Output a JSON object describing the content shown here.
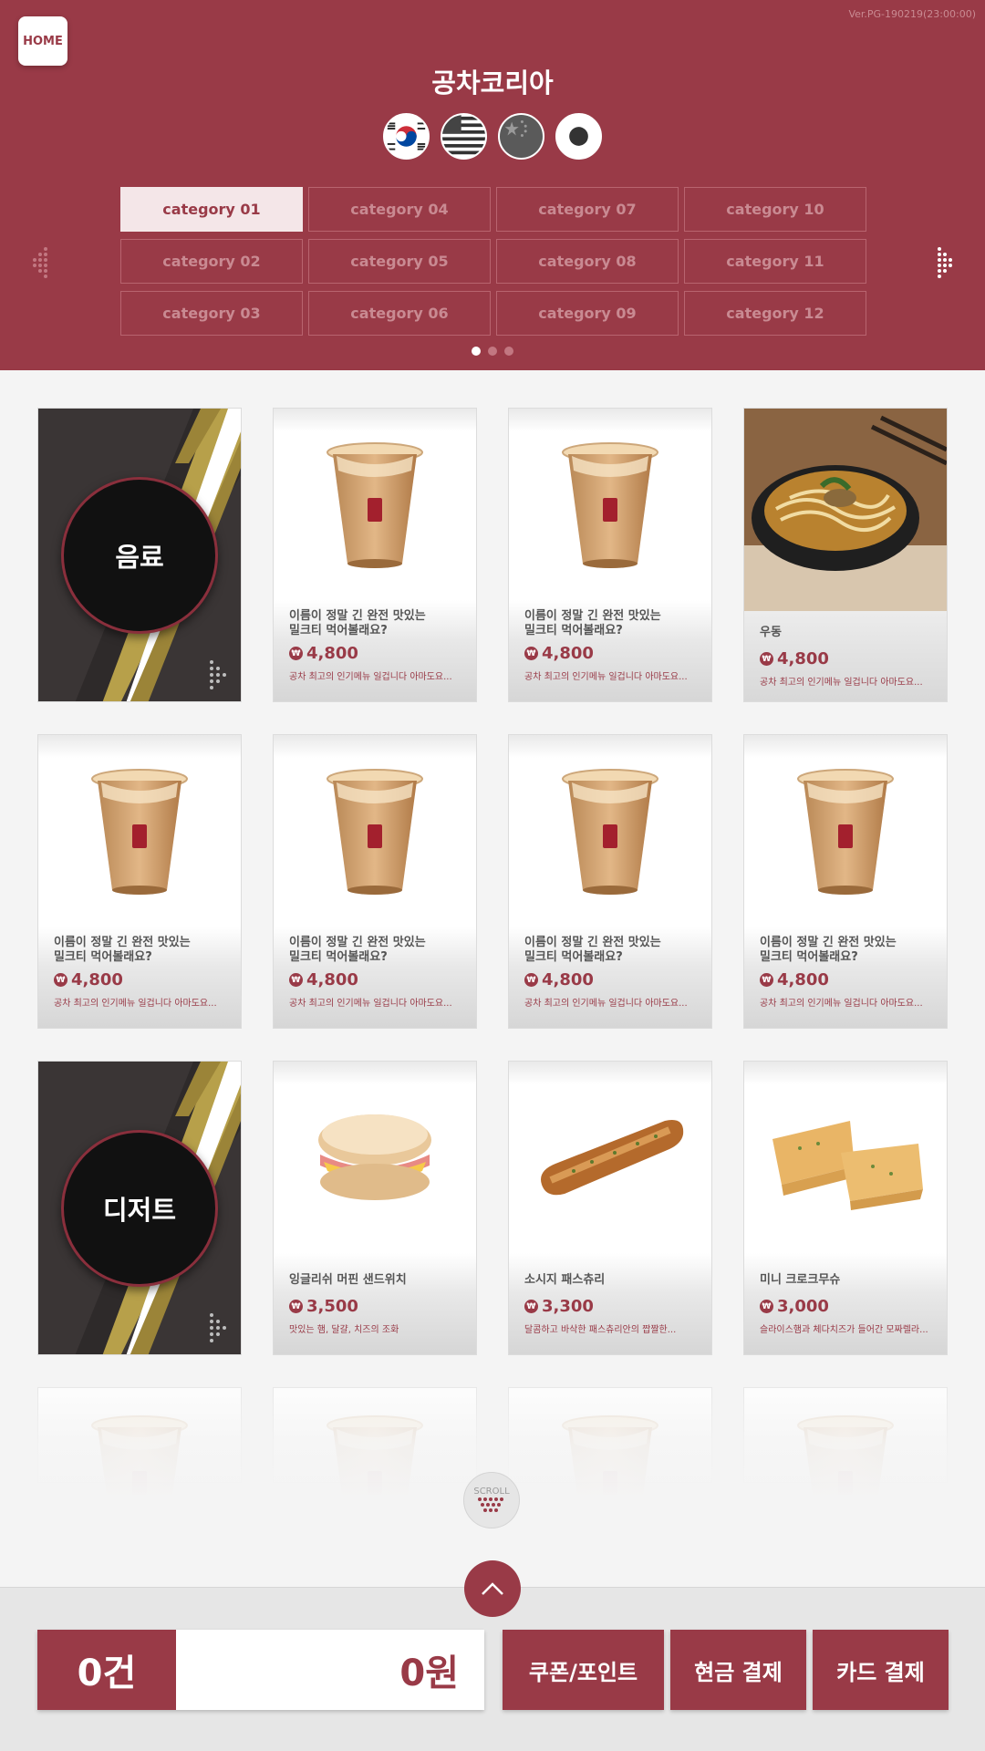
{
  "header": {
    "home_label": "HOME",
    "version": "Ver.PG-190219(23:00:00)",
    "title": "공차코리아",
    "languages": [
      "korea-flag-icon",
      "usa-flag-icon",
      "china-flag-icon",
      "japan-flag-icon"
    ],
    "categories": [
      {
        "label": "category 01",
        "active": true
      },
      {
        "label": "category 02",
        "active": false
      },
      {
        "label": "category 03",
        "active": false
      },
      {
        "label": "category 04",
        "active": false
      },
      {
        "label": "category 05",
        "active": false
      },
      {
        "label": "category 06",
        "active": false
      },
      {
        "label": "category 07",
        "active": false
      },
      {
        "label": "category 08",
        "active": false
      },
      {
        "label": "category 09",
        "active": false
      },
      {
        "label": "category 10",
        "active": false
      },
      {
        "label": "category 11",
        "active": false
      },
      {
        "label": "category 12",
        "active": false
      }
    ],
    "page_dots": {
      "count": 3,
      "active_index": 0
    }
  },
  "sections": {
    "drinks_label": "음료",
    "dessert_label": "디저트"
  },
  "products": [
    {
      "name": "이름이 정말 긴 완전 맛있는\n밀크티 먹어볼래요?",
      "price": "4,800",
      "desc": "공차 최고의 인기메뉴 일겁니다 아마도요...",
      "icon": "milk-tea-icon"
    },
    {
      "name": "이름이 정말 긴 완전 맛있는\n밀크티 먹어볼래요?",
      "price": "4,800",
      "desc": "공차 최고의 인기메뉴 일겁니다 아마도요...",
      "icon": "milk-tea-icon"
    },
    {
      "name": "우동",
      "price": "4,800",
      "desc": "공차 최고의 인기메뉴 일겁니다 아마도요...",
      "icon": "udon-icon"
    },
    {
      "name": "이름이 정말 긴 완전 맛있는\n밀크티 먹어볼래요?",
      "price": "4,800",
      "desc": "공차 최고의 인기메뉴 일겁니다 아마도요...",
      "icon": "milk-tea-icon"
    },
    {
      "name": "이름이 정말 긴 완전 맛있는\n밀크티 먹어볼래요?",
      "price": "4,800",
      "desc": "공차 최고의 인기메뉴 일겁니다 아마도요...",
      "icon": "milk-tea-icon"
    },
    {
      "name": "이름이 정말 긴 완전 맛있는\n밀크티 먹어볼래요?",
      "price": "4,800",
      "desc": "공차 최고의 인기메뉴 일겁니다 아마도요...",
      "icon": "milk-tea-icon"
    },
    {
      "name": "이름이 정말 긴 완전 맛있는\n밀크티 먹어볼래요?",
      "price": "4,800",
      "desc": "공차 최고의 인기메뉴 일겁니다 아마도요...",
      "icon": "milk-tea-icon"
    },
    {
      "name": "잉글리쉬 머핀 샌드위치",
      "price": "3,500",
      "desc": "맛있는 햄, 달걀, 치즈의 조화",
      "icon": "muffin-sandwich-icon"
    },
    {
      "name": "소시지 패스츄리",
      "price": "3,300",
      "desc": "달콤하고 바삭한 패스츄리안의 짭짤한...",
      "icon": "sausage-pastry-icon"
    },
    {
      "name": "미니 크로크무슈",
      "price": "3,000",
      "desc": "슬라이스햄과 체다치즈가 들어간 모짜렐라...",
      "icon": "croque-monsieur-icon"
    }
  ],
  "scroll_label": "SCROLL",
  "footer": {
    "count": "0건",
    "total": "0원",
    "coupon_label": "쿠폰/포인트",
    "cash_label": "현금 결제",
    "card_label": "카드 결제"
  },
  "colors": {
    "brand": "#993a47",
    "category_active_bg": "#f4e6e8",
    "banner_gold": "#b7a04a"
  }
}
